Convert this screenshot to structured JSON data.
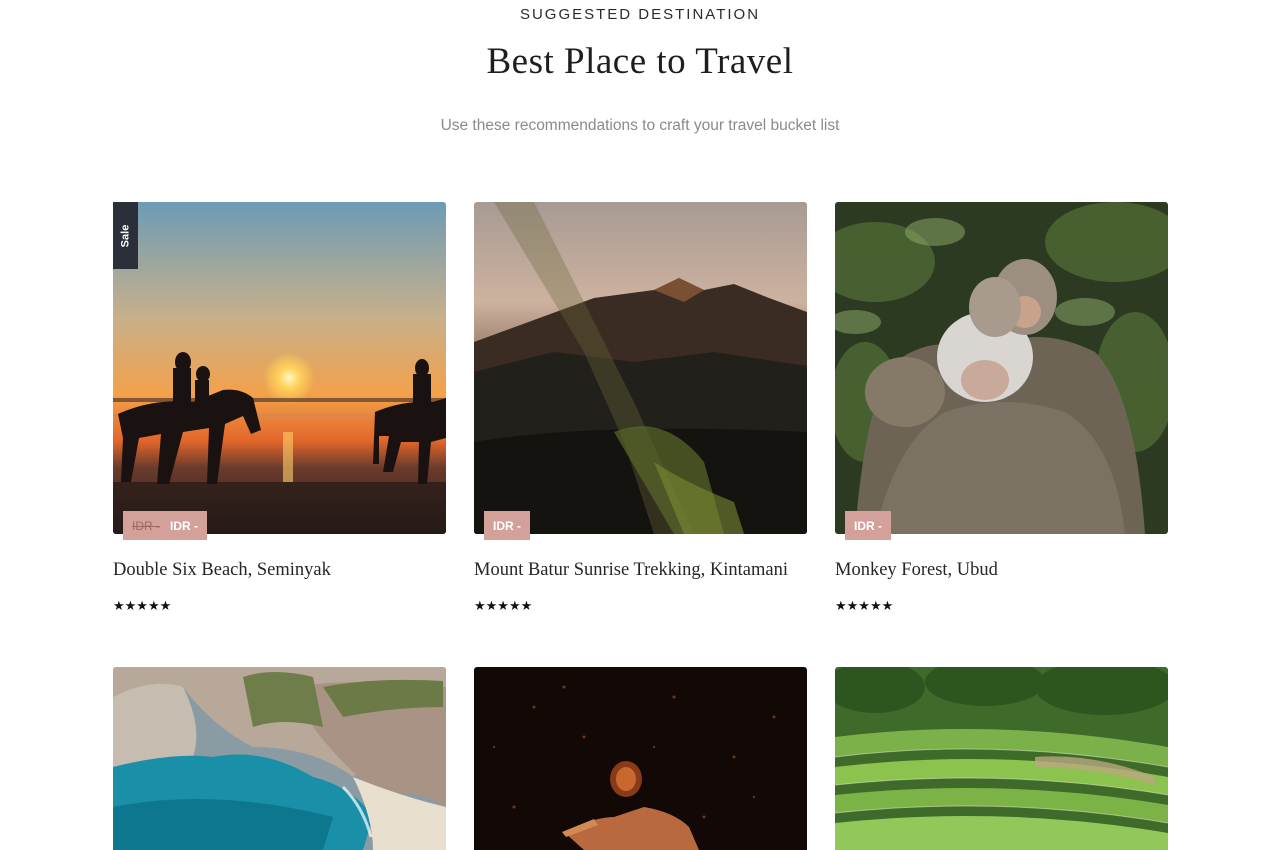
{
  "section": {
    "eyebrow": "SUGGESTED DESTINATION",
    "title": "Best Place to Travel",
    "subtitle": "Use these recommendations to craft your travel bucket list"
  },
  "cards": [
    {
      "name": "Double Six Beach, Seminyak",
      "sale_label": "Sale",
      "old_price": "IDR -",
      "price": "IDR -",
      "rating": 5,
      "stars": "★★★★★"
    },
    {
      "name": "Mount Batur Sunrise Trekking, Kintamani",
      "price": "IDR -",
      "rating": 5,
      "stars": "★★★★★"
    },
    {
      "name": "Monkey Forest, Ubud",
      "price": "IDR -",
      "rating": 5,
      "stars": "★★★★★"
    },
    {
      "name": "",
      "price": ""
    },
    {
      "name": "",
      "price": ""
    },
    {
      "name": "",
      "price": ""
    }
  ],
  "colors": {
    "sale_badge": "#2b2f3a",
    "price_badge": "#d4a19a"
  }
}
